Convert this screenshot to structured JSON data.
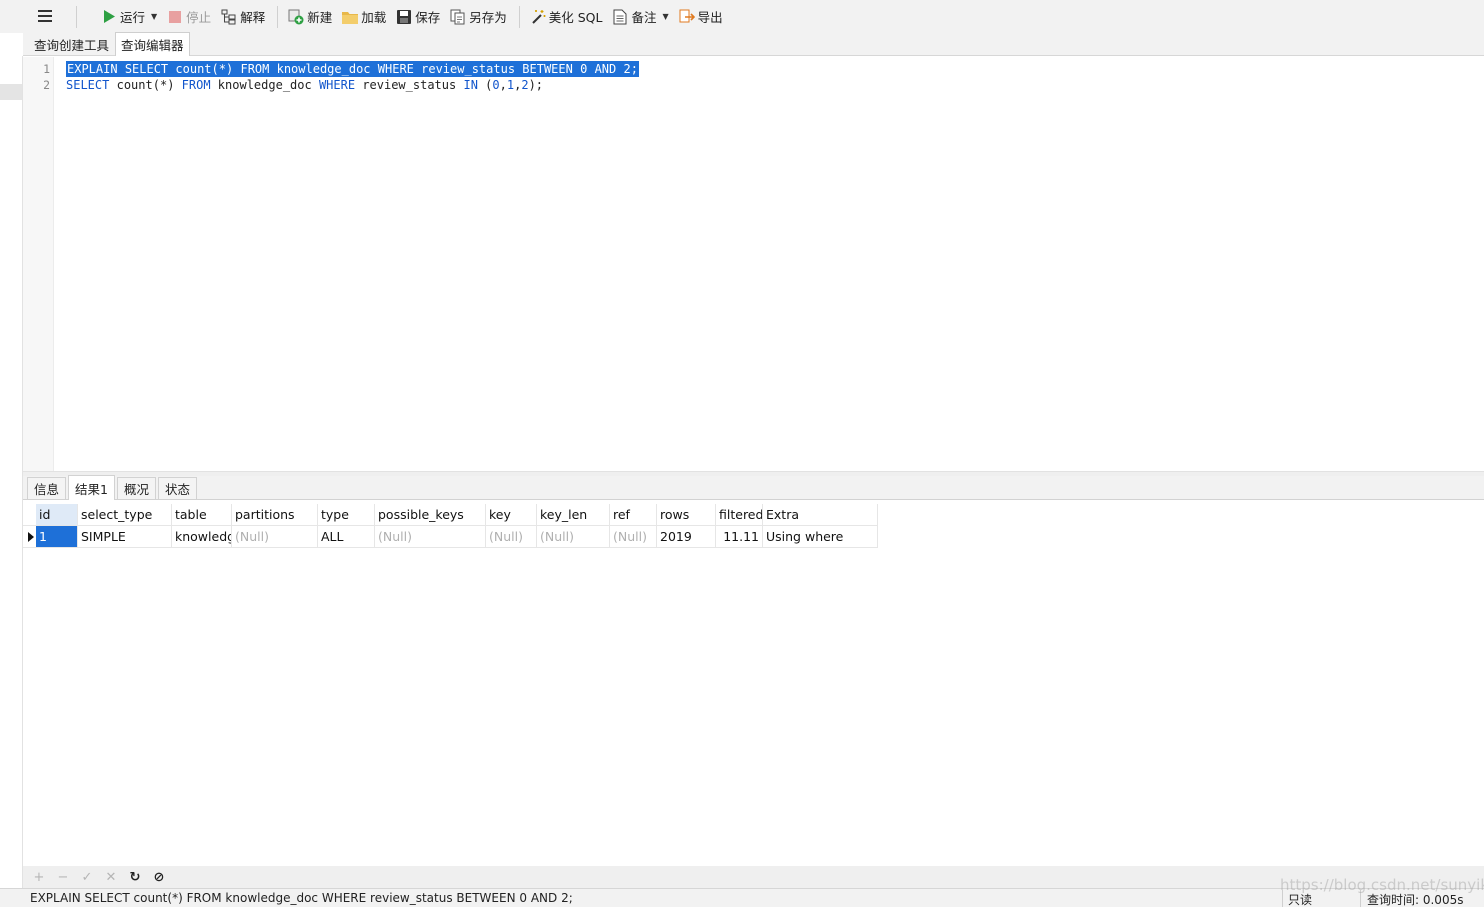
{
  "toolbar": {
    "run_label": "运行",
    "stop_label": "停止",
    "explain_label": "解释",
    "new_label": "新建",
    "load_label": "加载",
    "save_label": "保存",
    "save_as_label": "另存为",
    "beautify_label": "美化 SQL",
    "comment_label": "备注",
    "export_label": "导出"
  },
  "editor_tabs": [
    {
      "label": "查询创建工具",
      "active": false
    },
    {
      "label": "查询编辑器",
      "active": true
    }
  ],
  "editor": {
    "line_numbers": [
      "1",
      "2"
    ],
    "lines": [
      "EXPLAIN SELECT count(*) FROM knowledge_doc WHERE review_status BETWEEN 0 AND 2;",
      "SELECT count(*) FROM knowledge_doc WHERE review_status IN (0,1,2);"
    ]
  },
  "result_tabs": [
    {
      "label": "信息",
      "active": false
    },
    {
      "label": "结果1",
      "active": true
    },
    {
      "label": "概况",
      "active": false
    },
    {
      "label": "状态",
      "active": false
    }
  ],
  "grid": {
    "columns": [
      "id",
      "select_type",
      "table",
      "partitions",
      "type",
      "possible_keys",
      "key",
      "key_len",
      "ref",
      "rows",
      "filtered",
      "Extra"
    ],
    "rows": [
      [
        "1",
        "SIMPLE",
        "knowledg",
        "(Null)",
        "ALL",
        "(Null)",
        "(Null)",
        "(Null)",
        "(Null)",
        "2019",
        "11.11",
        "Using where"
      ]
    ]
  },
  "grid_actions": {
    "add": "+",
    "remove": "−",
    "apply": "✓",
    "discard": "✕",
    "refresh": "↻",
    "stop": "⊘"
  },
  "status": {
    "sql": "EXPLAIN SELECT count(*) FROM knowledge_doc WHERE review_status BETWEEN 0 AND 2;",
    "mode": "只读",
    "time": "查询时间: 0.005s"
  },
  "watermark": "https://blog.csdn.net/sunyikk",
  "colors": {
    "selection": "#1e70d8",
    "keyword": "#1155cc",
    "run_green": "#2ea043",
    "stop_red": "#e06060"
  }
}
